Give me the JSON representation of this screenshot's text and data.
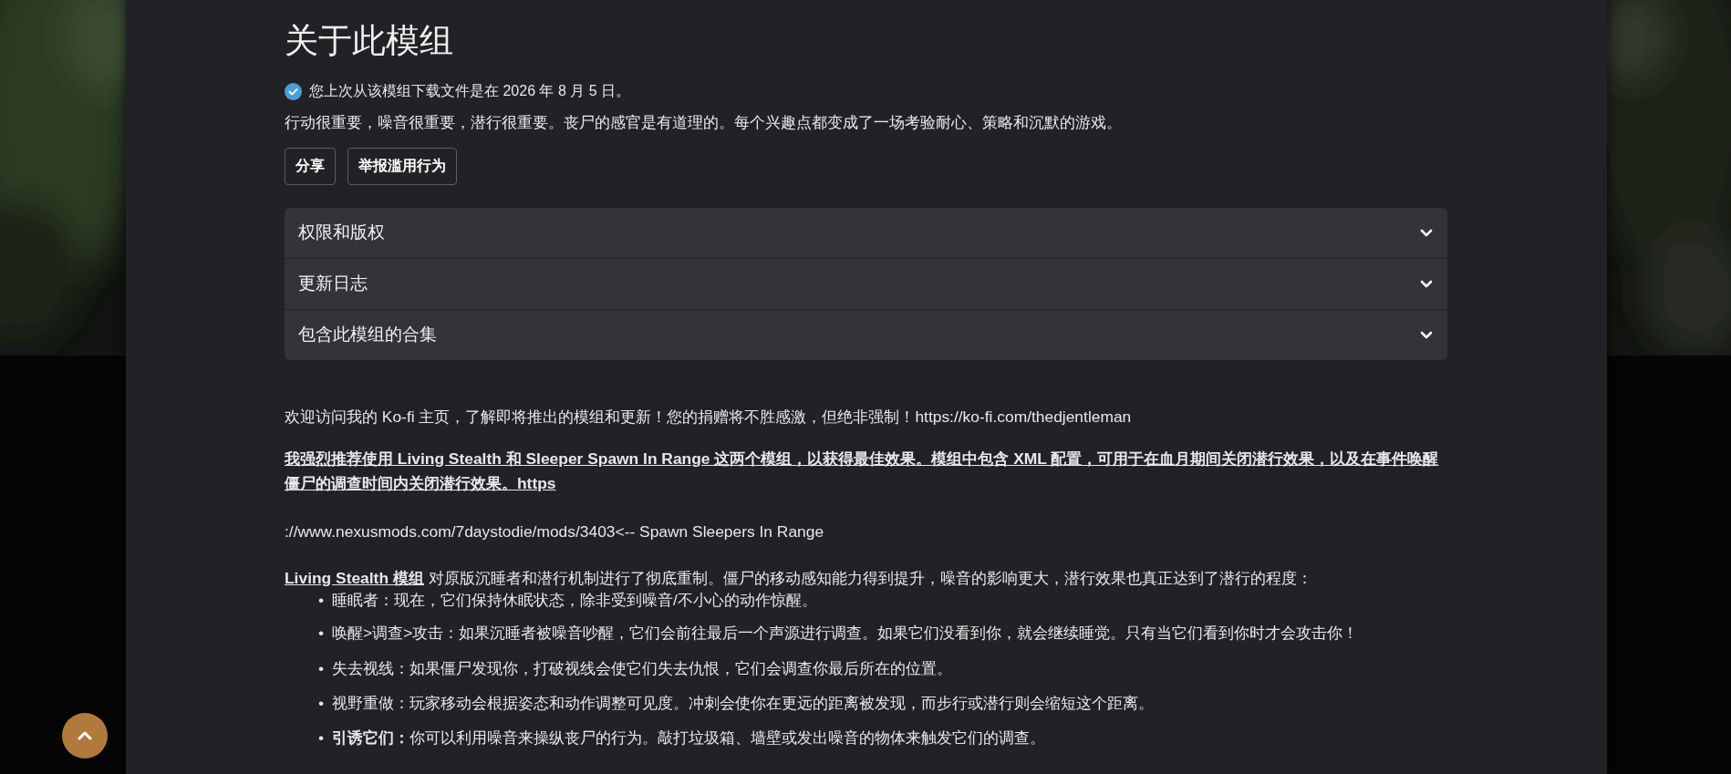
{
  "title": "关于此模组",
  "download_notice": {
    "text": "您上次从该模组下载文件是在 2026 年 8 月 5 日。",
    "verified": true
  },
  "summary": "行动很重要，噪音很重要，潜行很重要。丧尸的感官是有道理的。每个兴趣点都变成了一场考验耐心、策略和沉默的游戏。",
  "buttons": [
    "分享",
    "举报滥用行为"
  ],
  "sections": [
    {
      "label": "权限和版权",
      "expanded": false
    },
    {
      "label": "更新日志",
      "expanded": false
    },
    {
      "label": "包含此模组的合集",
      "expanded": false
    }
  ],
  "description": {
    "kofi": "欢迎访问我的 Ko-fi 主页，了解即将推出的模组和更新！您的捐赠将不胜感激，但绝非强制！https://ko-fi.com/thedjentleman",
    "recommendation": "我强烈推荐使用 Living Stealth 和 Sleeper Spawn In Range 这两个模组，以获得最佳效果。模组中包含 XML 配置，可用于在血月期间关闭潜行效果，以及在事件唤醒僵尸的调查时间内关闭潜行效果。https",
    "nexus_line": "://www.nexusmods.com/7daystodie/mods/3403<-- Spawn Sleepers In Range",
    "intro": "**Living Stealth 模组** 对原版沉睡者和潜行机制进行了彻底重制。僵尸的移动感知能力得到提升，噪音的影响更大，潜行效果也真正达到了潜行的程度：",
    "bullets": [
      {
        "marker": "•",
        "text": "睡眠者：现在，它们保持休眠状态，除非受到噪音/不小心的动作惊醒。"
      },
      {
        "marker": "•",
        "text": "唤醒>调查>攻击：如果沉睡者被噪音吵醒，它们会前往最后一个声源进行调查。如果它们没看到你，就会继续睡觉。只有当它们看到你时才会攻击你！"
      },
      {
        "marker": "•",
        "text": "失去视线：如果僵尸发现你，打破视线会使它们失去仇恨，它们会调查你最后所在的位置。"
      },
      {
        "marker": "•",
        "text": "视野重做：玩家移动会根据姿态和动作调整可见度。冲刺会使你在更远的距离被发现，而步行或潜行则会缩短这个距离。"
      },
      {
        "marker": "•",
        "text": "**引诱它们：**你可以利用噪音来操纵丧尸的行为。敲打垃圾箱、墙壁或发出噪音的物体来触发它们的调查。"
      }
    ]
  }
}
